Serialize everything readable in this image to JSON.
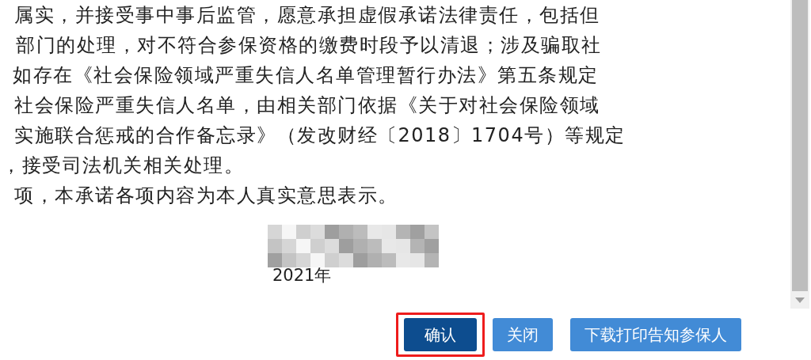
{
  "promise_text": {
    "lines": [
      "属实，并接受事中事后监管，愿意承担虚假承诺法律责任，包括但",
      "部门的处理，对不符合参保资格的缴费时段予以清退；涉及骗取社",
      "如存在《社会保险领域严重失信人名单管理暂行办法》第五条规定",
      "社会保险严重失信人名单，由相关部门依据《关于对社会保险领域",
      "实施联合惩戒的合作备忘录》（发改财经〔2018〕1704号）等规定",
      "，接受司法机关相关处理。",
      "项，本承诺各项内容为本人真实意思表示。"
    ]
  },
  "signature": {
    "date": "2021年"
  },
  "buttons": [
    {
      "label": "确认",
      "kind": "primary",
      "highlighted": true
    },
    {
      "label": "关闭",
      "kind": "default",
      "highlighted": false
    },
    {
      "label": "下载打印告知参保人",
      "kind": "default",
      "highlighted": false
    }
  ]
}
